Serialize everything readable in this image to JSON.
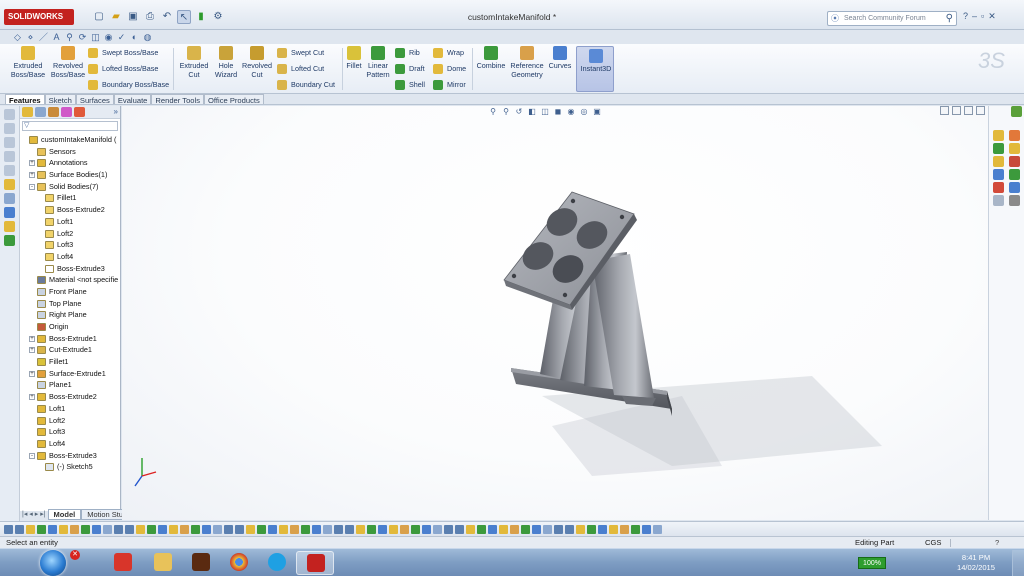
{
  "app": {
    "logo": "SOLIDWORKS",
    "document_title": "customIntakeManifold *",
    "search_placeholder": "Search Community Forum"
  },
  "ribbon": {
    "extruded_boss": "Extruded Boss/Base",
    "revolved_boss": "Revolved Boss/Base",
    "swept_boss": "Swept Boss/Base",
    "lofted_boss": "Lofted Boss/Base",
    "boundary_boss": "Boundary Boss/Base",
    "extruded_cut": "Extruded Cut",
    "hole_wizard": "Hole Wizard",
    "revolved_cut": "Revolved Cut",
    "swept_cut": "Swept Cut",
    "lofted_cut": "Lofted Cut",
    "boundary_cut": "Boundary Cut",
    "fillet": "Fillet",
    "linear_pattern": "Linear Pattern",
    "rib": "Rib",
    "draft": "Draft",
    "shell": "Shell",
    "wrap": "Wrap",
    "dome": "Dome",
    "mirror": "Mirror",
    "combine": "Combine",
    "reference_geometry": "Reference Geometry",
    "curves": "Curves",
    "instant3d": "Instant3D"
  },
  "tabs": [
    "Features",
    "Sketch",
    "Surfaces",
    "Evaluate",
    "Render Tools",
    "Office Products"
  ],
  "feature_tree": {
    "filter_value": "",
    "items": [
      {
        "label": "customIntakeManifold  (",
        "level": 0,
        "toggle": "",
        "icon": "part-icon"
      },
      {
        "label": "Sensors",
        "level": 1,
        "toggle": "",
        "icon": "folder-icon"
      },
      {
        "label": "Annotations",
        "level": 1,
        "toggle": "+",
        "icon": "annotation-icon"
      },
      {
        "label": "Surface Bodies(1)",
        "level": 1,
        "toggle": "+",
        "icon": "folder-icon"
      },
      {
        "label": "Solid Bodies(7)",
        "level": 1,
        "toggle": "-",
        "icon": "folder-icon"
      },
      {
        "label": "Fillet1",
        "level": 2,
        "toggle": "",
        "icon": "body-icon"
      },
      {
        "label": "Boss-Extrude2",
        "level": 2,
        "toggle": "",
        "icon": "body-icon"
      },
      {
        "label": "Loft1",
        "level": 2,
        "toggle": "",
        "icon": "body-icon"
      },
      {
        "label": "Loft2",
        "level": 2,
        "toggle": "",
        "icon": "body-icon"
      },
      {
        "label": "Loft3",
        "level": 2,
        "toggle": "",
        "icon": "body-icon"
      },
      {
        "label": "Loft4",
        "level": 2,
        "toggle": "",
        "icon": "body-icon"
      },
      {
        "label": "Boss-Extrude3",
        "level": 2,
        "toggle": "",
        "icon": "hidden-body-icon"
      },
      {
        "label": "Material <not specifie",
        "level": 1,
        "toggle": "",
        "icon": "material-icon"
      },
      {
        "label": "Front Plane",
        "level": 1,
        "toggle": "",
        "icon": "plane-icon"
      },
      {
        "label": "Top Plane",
        "level": 1,
        "toggle": "",
        "icon": "plane-icon"
      },
      {
        "label": "Right Plane",
        "level": 1,
        "toggle": "",
        "icon": "plane-icon"
      },
      {
        "label": "Origin",
        "level": 1,
        "toggle": "",
        "icon": "origin-icon"
      },
      {
        "label": "Boss-Extrude1",
        "level": 1,
        "toggle": "+",
        "icon": "extrude-icon"
      },
      {
        "label": "Cut-Extrude1",
        "level": 1,
        "toggle": "+",
        "icon": "cut-icon"
      },
      {
        "label": "Fillet1",
        "level": 1,
        "toggle": "",
        "icon": "fillet-icon"
      },
      {
        "label": "Surface-Extrude1",
        "level": 1,
        "toggle": "+",
        "icon": "surface-icon"
      },
      {
        "label": "Plane1",
        "level": 1,
        "toggle": "",
        "icon": "plane-icon"
      },
      {
        "label": "Boss-Extrude2",
        "level": 1,
        "toggle": "+",
        "icon": "extrude-icon"
      },
      {
        "label": "Loft1",
        "level": 1,
        "toggle": "",
        "icon": "loft-icon"
      },
      {
        "label": "Loft2",
        "level": 1,
        "toggle": "",
        "icon": "loft-icon"
      },
      {
        "label": "Loft3",
        "level": 1,
        "toggle": "",
        "icon": "loft-icon"
      },
      {
        "label": "Loft4",
        "level": 1,
        "toggle": "",
        "icon": "loft-icon"
      },
      {
        "label": "Boss-Extrude3",
        "level": 1,
        "toggle": "-",
        "icon": "extrude-icon"
      },
      {
        "label": "(-) Sketch5",
        "level": 2,
        "toggle": "",
        "icon": "sketch-icon"
      }
    ]
  },
  "model_tabs": [
    "Model",
    "Motion Study 1"
  ],
  "status": {
    "message": "Select an entity",
    "mode": "Editing Part",
    "units": "CGS",
    "help": "?"
  },
  "taskbar": {
    "battery": "100%",
    "time": "8:41 PM",
    "date": "14/02/2015"
  },
  "colors": {
    "brand_red": "#c3221f",
    "ribbon_text": "#1f3a66",
    "model_gray": "#8d9097"
  }
}
